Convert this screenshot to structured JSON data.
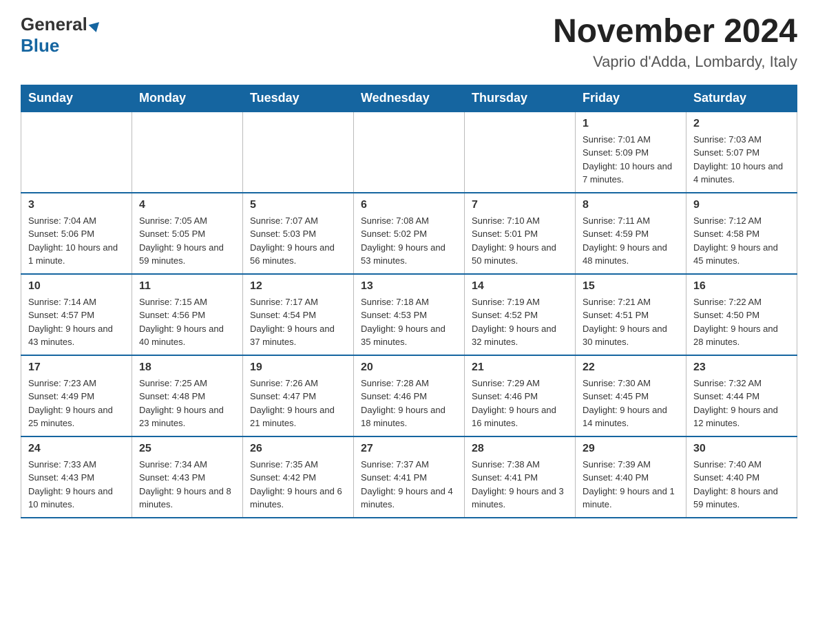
{
  "header": {
    "logo_general": "General",
    "logo_blue": "Blue",
    "title": "November 2024",
    "location": "Vaprio d'Adda, Lombardy, Italy"
  },
  "weekdays": [
    "Sunday",
    "Monday",
    "Tuesday",
    "Wednesday",
    "Thursday",
    "Friday",
    "Saturday"
  ],
  "weeks": [
    [
      {
        "day": "",
        "info": ""
      },
      {
        "day": "",
        "info": ""
      },
      {
        "day": "",
        "info": ""
      },
      {
        "day": "",
        "info": ""
      },
      {
        "day": "",
        "info": ""
      },
      {
        "day": "1",
        "info": "Sunrise: 7:01 AM\nSunset: 5:09 PM\nDaylight: 10 hours and 7 minutes."
      },
      {
        "day": "2",
        "info": "Sunrise: 7:03 AM\nSunset: 5:07 PM\nDaylight: 10 hours and 4 minutes."
      }
    ],
    [
      {
        "day": "3",
        "info": "Sunrise: 7:04 AM\nSunset: 5:06 PM\nDaylight: 10 hours and 1 minute."
      },
      {
        "day": "4",
        "info": "Sunrise: 7:05 AM\nSunset: 5:05 PM\nDaylight: 9 hours and 59 minutes."
      },
      {
        "day": "5",
        "info": "Sunrise: 7:07 AM\nSunset: 5:03 PM\nDaylight: 9 hours and 56 minutes."
      },
      {
        "day": "6",
        "info": "Sunrise: 7:08 AM\nSunset: 5:02 PM\nDaylight: 9 hours and 53 minutes."
      },
      {
        "day": "7",
        "info": "Sunrise: 7:10 AM\nSunset: 5:01 PM\nDaylight: 9 hours and 50 minutes."
      },
      {
        "day": "8",
        "info": "Sunrise: 7:11 AM\nSunset: 4:59 PM\nDaylight: 9 hours and 48 minutes."
      },
      {
        "day": "9",
        "info": "Sunrise: 7:12 AM\nSunset: 4:58 PM\nDaylight: 9 hours and 45 minutes."
      }
    ],
    [
      {
        "day": "10",
        "info": "Sunrise: 7:14 AM\nSunset: 4:57 PM\nDaylight: 9 hours and 43 minutes."
      },
      {
        "day": "11",
        "info": "Sunrise: 7:15 AM\nSunset: 4:56 PM\nDaylight: 9 hours and 40 minutes."
      },
      {
        "day": "12",
        "info": "Sunrise: 7:17 AM\nSunset: 4:54 PM\nDaylight: 9 hours and 37 minutes."
      },
      {
        "day": "13",
        "info": "Sunrise: 7:18 AM\nSunset: 4:53 PM\nDaylight: 9 hours and 35 minutes."
      },
      {
        "day": "14",
        "info": "Sunrise: 7:19 AM\nSunset: 4:52 PM\nDaylight: 9 hours and 32 minutes."
      },
      {
        "day": "15",
        "info": "Sunrise: 7:21 AM\nSunset: 4:51 PM\nDaylight: 9 hours and 30 minutes."
      },
      {
        "day": "16",
        "info": "Sunrise: 7:22 AM\nSunset: 4:50 PM\nDaylight: 9 hours and 28 minutes."
      }
    ],
    [
      {
        "day": "17",
        "info": "Sunrise: 7:23 AM\nSunset: 4:49 PM\nDaylight: 9 hours and 25 minutes."
      },
      {
        "day": "18",
        "info": "Sunrise: 7:25 AM\nSunset: 4:48 PM\nDaylight: 9 hours and 23 minutes."
      },
      {
        "day": "19",
        "info": "Sunrise: 7:26 AM\nSunset: 4:47 PM\nDaylight: 9 hours and 21 minutes."
      },
      {
        "day": "20",
        "info": "Sunrise: 7:28 AM\nSunset: 4:46 PM\nDaylight: 9 hours and 18 minutes."
      },
      {
        "day": "21",
        "info": "Sunrise: 7:29 AM\nSunset: 4:46 PM\nDaylight: 9 hours and 16 minutes."
      },
      {
        "day": "22",
        "info": "Sunrise: 7:30 AM\nSunset: 4:45 PM\nDaylight: 9 hours and 14 minutes."
      },
      {
        "day": "23",
        "info": "Sunrise: 7:32 AM\nSunset: 4:44 PM\nDaylight: 9 hours and 12 minutes."
      }
    ],
    [
      {
        "day": "24",
        "info": "Sunrise: 7:33 AM\nSunset: 4:43 PM\nDaylight: 9 hours and 10 minutes."
      },
      {
        "day": "25",
        "info": "Sunrise: 7:34 AM\nSunset: 4:43 PM\nDaylight: 9 hours and 8 minutes."
      },
      {
        "day": "26",
        "info": "Sunrise: 7:35 AM\nSunset: 4:42 PM\nDaylight: 9 hours and 6 minutes."
      },
      {
        "day": "27",
        "info": "Sunrise: 7:37 AM\nSunset: 4:41 PM\nDaylight: 9 hours and 4 minutes."
      },
      {
        "day": "28",
        "info": "Sunrise: 7:38 AM\nSunset: 4:41 PM\nDaylight: 9 hours and 3 minutes."
      },
      {
        "day": "29",
        "info": "Sunrise: 7:39 AM\nSunset: 4:40 PM\nDaylight: 9 hours and 1 minute."
      },
      {
        "day": "30",
        "info": "Sunrise: 7:40 AM\nSunset: 4:40 PM\nDaylight: 8 hours and 59 minutes."
      }
    ]
  ]
}
